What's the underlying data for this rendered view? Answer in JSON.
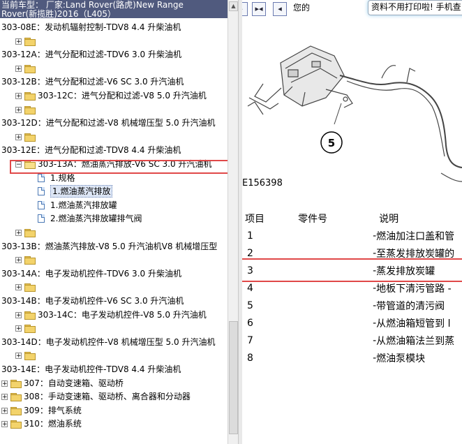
{
  "header": {
    "line1": "当前车型： 厂家:Land Rover(路虎)New Range",
    "line2": "Rover(新揽胜)2016（L405）"
  },
  "tree": [
    {
      "label": "303-08E：发动机辐射控制-TDV8 4.4 升柴油机",
      "level": 0,
      "node": "leaf"
    },
    {
      "label": "",
      "level": 1,
      "node": "plus"
    },
    {
      "label": "303-12A：进气分配和过滤-TDV6 3.0 升柴油机",
      "level": 0,
      "node": "leaf"
    },
    {
      "label": "",
      "level": 1,
      "node": "plus"
    },
    {
      "label": "303-12B：进气分配和过滤-V6 SC 3.0 升汽油机",
      "level": 0,
      "node": "leaf"
    },
    {
      "label": "303-12C：进气分配和过滤-V8 5.0 升汽油机",
      "level": 1,
      "node": "plus"
    },
    {
      "label": "",
      "level": 1,
      "node": "plus"
    },
    {
      "label": "303-12D：进气分配和过滤-V8 机械增压型 5.0 升汽油机",
      "level": 0,
      "node": "leaf"
    },
    {
      "label": "",
      "level": 1,
      "node": "plus"
    },
    {
      "label": "303-12E：进气分配和过滤-TDV8 4.4 升柴油机",
      "level": 0,
      "node": "leaf"
    },
    {
      "label": "303-13A：燃油蒸汽排放-V6 SC 3.0 升汽油机",
      "level": 1,
      "node": "minus"
    },
    {
      "label": "1.规格",
      "level": 2,
      "node": "doc"
    },
    {
      "label": "1.燃油蒸汽排放",
      "level": 2,
      "node": "doc",
      "selected": true
    },
    {
      "label": "1.燃油蒸汽排放罐",
      "level": 2,
      "node": "doc"
    },
    {
      "label": "2.燃油蒸汽排放罐排气阀",
      "level": 2,
      "node": "doc"
    },
    {
      "label": "",
      "level": 1,
      "node": "plus"
    },
    {
      "label": "303-13B：燃油蒸汽排放-V8 5.0 升汽油机V8 机械增压型",
      "level": 0,
      "node": "leaf"
    },
    {
      "label": "",
      "level": 1,
      "node": "plus"
    },
    {
      "label": "303-14A：电子发动机控件-TDV6 3.0 升柴油机",
      "level": 0,
      "node": "leaf"
    },
    {
      "label": "",
      "level": 1,
      "node": "plus"
    },
    {
      "label": "303-14B：电子发动机控件-V6 SC 3.0 升汽油机",
      "level": 0,
      "node": "leaf"
    },
    {
      "label": "303-14C：电子发动机控件-V8 5.0 升汽油机",
      "level": 1,
      "node": "plus"
    },
    {
      "label": "",
      "level": 1,
      "node": "plus"
    },
    {
      "label": "303-14D：电子发动机控件-V8 机械增压型 5.0 升汽油机",
      "level": 0,
      "node": "leaf"
    },
    {
      "label": "",
      "level": 1,
      "node": "plus"
    },
    {
      "label": "303-14E：电子发动机控件-TDV8 4.4 升柴油机",
      "level": 0,
      "node": "leaf"
    },
    {
      "label": "307：自动变速箱、驱动桥",
      "level": 0,
      "node": "plus"
    },
    {
      "label": "308：手动变速箱、驱动桥、离合器和分动器",
      "level": 0,
      "node": "plus"
    },
    {
      "label": "309：排气系统",
      "level": 0,
      "node": "plus"
    },
    {
      "label": "310：燃油系统",
      "level": 0,
      "node": "plus"
    }
  ],
  "toolbar": {
    "note": "您的",
    "banner": "资料不用打印啦! 手机查"
  },
  "figure": {
    "id": "E156398",
    "callout": "5"
  },
  "parts": {
    "headers": [
      "项目",
      "零件号",
      "说明"
    ],
    "rows": [
      {
        "item": "1",
        "part": "-",
        "desc": "燃油加注口盖和管"
      },
      {
        "item": "2",
        "part": "-",
        "desc": "至蒸发排放炭罐的"
      },
      {
        "item": "3",
        "part": "-",
        "desc": "蒸发排放炭罐"
      },
      {
        "item": "4",
        "part": "-",
        "desc": "地板下清污管路 -"
      },
      {
        "item": "5",
        "part": "-",
        "desc": "带管道的清污阀"
      },
      {
        "item": "6",
        "part": "-",
        "desc": "从燃油箱短管到 l"
      },
      {
        "item": "7",
        "part": "-",
        "desc": "从燃油箱法兰到蒸"
      },
      {
        "item": "8",
        "part": "-",
        "desc": "燃油泵模块"
      }
    ]
  },
  "colors": {
    "highlight": "#e04848",
    "header_bg": "#505a7e"
  }
}
